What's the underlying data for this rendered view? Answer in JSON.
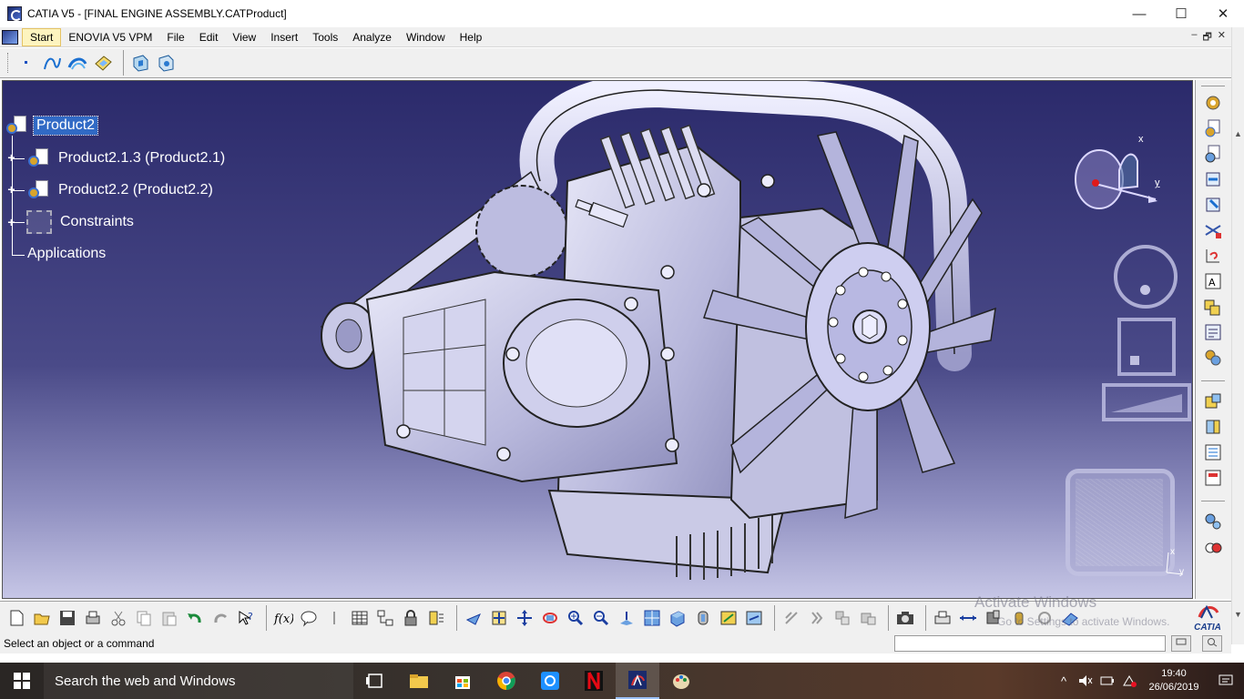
{
  "window": {
    "title": "CATIA V5 - [FINAL ENGINE ASSEMBLY.CATProduct]",
    "minimize": "—",
    "maximize": "☐",
    "close": "✕"
  },
  "menu": {
    "start": "Start",
    "enovia": "ENOVIA V5 VPM",
    "file": "File",
    "edit": "Edit",
    "view": "View",
    "insert": "Insert",
    "tools": "Tools",
    "analyze": "Analyze",
    "window": "Window",
    "help": "Help",
    "mdi_min": "–",
    "mdi_restore": "🗗",
    "mdi_close": "✕"
  },
  "tree": {
    "root": "Product2",
    "child1": "Product2.1.3 (Product2.1)",
    "child2": "Product2.2 (Product2.2)",
    "constraints": "Constraints",
    "applications": "Applications"
  },
  "compass": {
    "x_label": "x",
    "y_label": "y"
  },
  "mini_axis": {
    "x_label": "x",
    "y_label": "y"
  },
  "watermark": {
    "title": "Activate Windows",
    "subtitle": "Go to Settings to activate Windows."
  },
  "catia_logo": "CATIA",
  "status": {
    "message": "Select an object or a command",
    "command_input": ""
  },
  "taskbar": {
    "search_placeholder": "Search the web and Windows",
    "time": "19:40",
    "date": "26/06/2019"
  },
  "colors": {
    "viewport_top": "#2b2a6b",
    "viewport_bottom": "#c6c6e6",
    "selection": "#316ac5",
    "model": "#c8c8e8"
  }
}
